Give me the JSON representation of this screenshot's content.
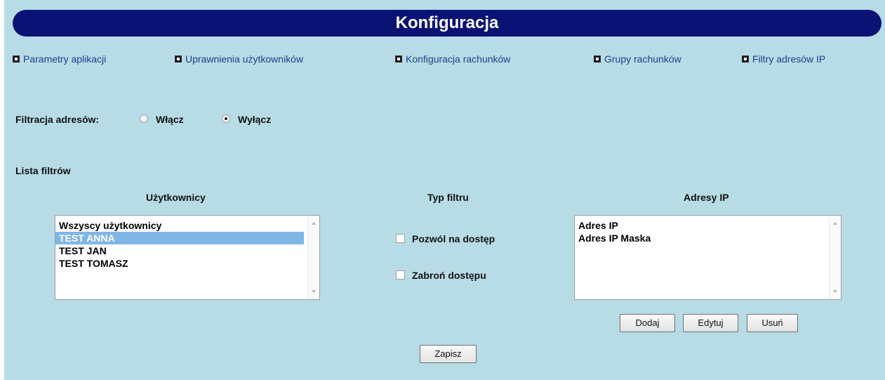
{
  "header": {
    "title": "Konfiguracja"
  },
  "nav": [
    {
      "label": "Parametry aplikacji"
    },
    {
      "label": "Uprawnienia użytkowników"
    },
    {
      "label": "Konfiguracja rachunków"
    },
    {
      "label": "Grupy rachunków"
    },
    {
      "label": "Filtry adresów IP"
    }
  ],
  "filter": {
    "label": "Filtracja adresów:",
    "options": [
      {
        "label": "Włącz",
        "checked": false
      },
      {
        "label": "Wyłącz",
        "checked": true
      }
    ]
  },
  "list_title": "Lista filtrów",
  "columns": {
    "users": "Użytkownicy",
    "type": "Typ filtru",
    "ips": "Adresy IP"
  },
  "users": {
    "items": [
      "Wszyscy użytkownicy",
      "TEST ANNA",
      "TEST JAN",
      "TEST TOMASZ"
    ],
    "selected": "TEST ANNA"
  },
  "filter_type": {
    "allow": {
      "label": "Pozwól na dostęp",
      "checked": false
    },
    "deny": {
      "label": "Zabroń dostępu",
      "checked": false
    }
  },
  "ips": {
    "items": [
      "Adres IP",
      "Adres IP Maska"
    ]
  },
  "buttons": {
    "add": "Dodaj",
    "edit": "Edytuj",
    "remove": "Usuń",
    "save": "Zapisz"
  },
  "colors": {
    "title_bar": "#0b1275",
    "panel": "#b7dce6",
    "link": "#1a3f8f",
    "selection": "#7fb6e8"
  }
}
